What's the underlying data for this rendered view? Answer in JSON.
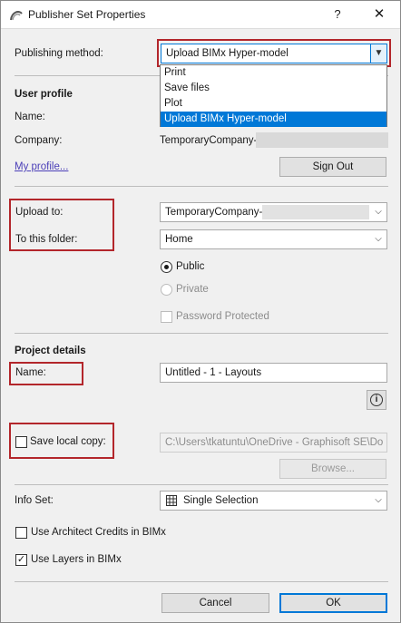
{
  "window": {
    "title": "Publisher Set Properties",
    "help_label": "?",
    "close_label": "✕",
    "app_icon": "archicad-logo-icon"
  },
  "publishing": {
    "label": "Publishing method:",
    "value": "Upload BIMx Hyper-model",
    "options": [
      "Print",
      "Save files",
      "Plot",
      "Upload BIMx Hyper-model"
    ],
    "selected_index": 3
  },
  "user_profile": {
    "heading": "User profile",
    "name_label": "Name:",
    "company_label": "Company:",
    "company_value": "TemporaryCompany-",
    "my_profile_link": "My profile...",
    "sign_out_label": "Sign Out"
  },
  "upload": {
    "upload_to_label": "Upload to:",
    "upload_to_value": "TemporaryCompany-",
    "folder_label": "To this folder:",
    "folder_value": "Home",
    "public_label": "Public",
    "private_label": "Private",
    "password_label": "Password Protected"
  },
  "project": {
    "heading": "Project details",
    "name_label": "Name:",
    "name_value": "Untitled - 1 - Layouts",
    "info_icon": "info-icon",
    "save_local_label": "Save local copy:",
    "local_path": "C:\\Users\\tkatuntu\\OneDrive - Graphisoft SE\\Do",
    "browse_label": "Browse..."
  },
  "info_set": {
    "label": "Info Set:",
    "value": "Single Selection",
    "icon": "grid-icon"
  },
  "options": {
    "architect_credits_label": "Use Architect Credits in BIMx",
    "architect_credits_checked": false,
    "layers_label": "Use Layers in BIMx",
    "layers_checked": true
  },
  "footer": {
    "cancel_label": "Cancel",
    "ok_label": "OK"
  },
  "colors": {
    "highlight_box": "#b3262b",
    "selection": "#0078d7",
    "link": "#4b3fb8"
  }
}
